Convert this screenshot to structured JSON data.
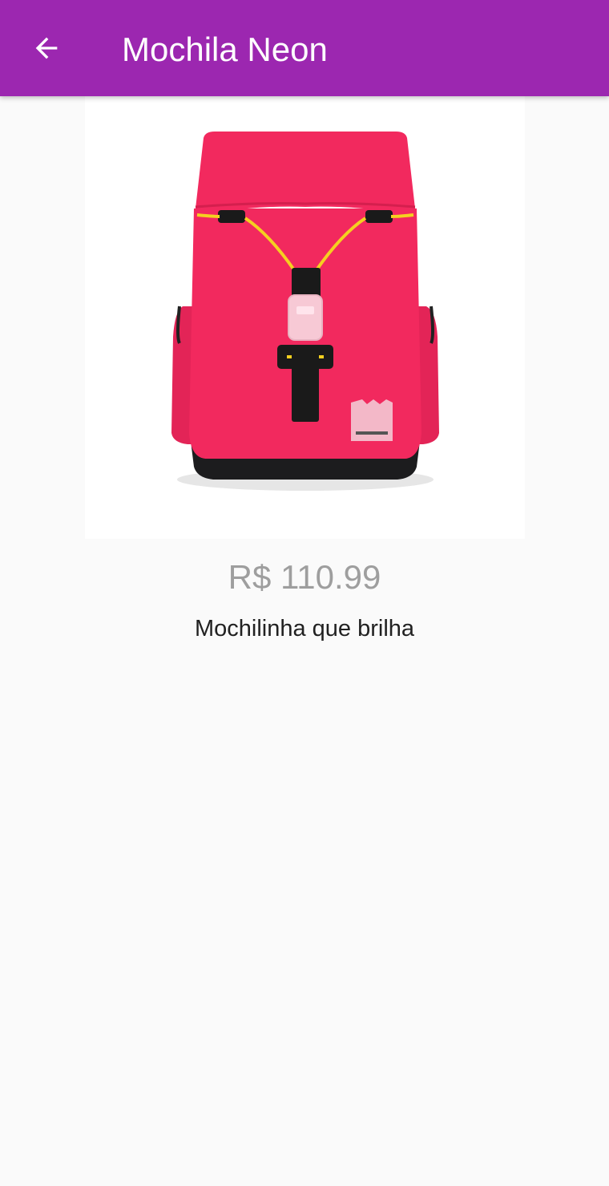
{
  "app_bar": {
    "title": "Mochila Neon",
    "back_icon": "arrow-left-icon",
    "background_color": "#9c27b0"
  },
  "product": {
    "image_subject": "backpack-image",
    "image_colors": {
      "body": "#f2295e",
      "straps": "#1a1a1a",
      "cord": "#f5d020"
    },
    "price": "R$ 110.99",
    "description": "Mochilinha que brilha"
  }
}
